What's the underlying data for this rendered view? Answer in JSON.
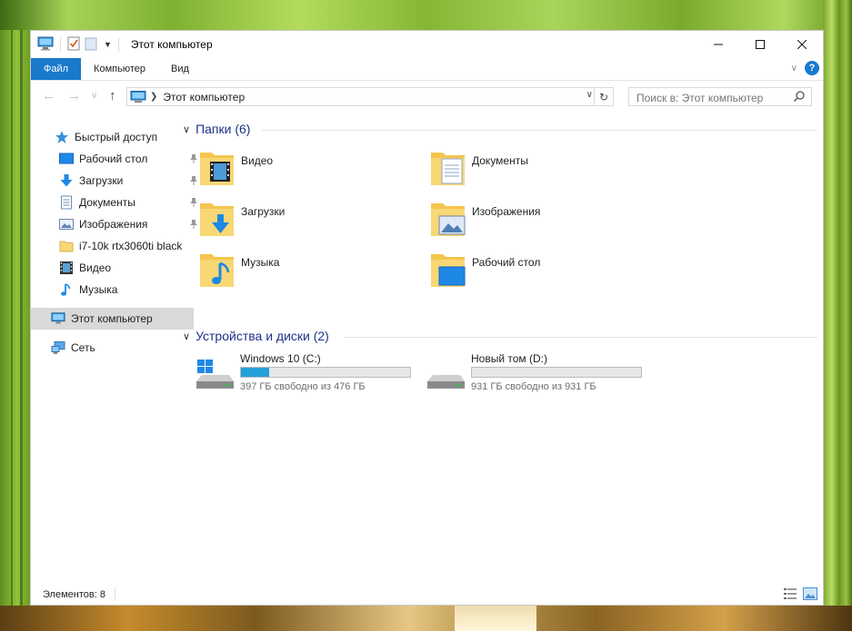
{
  "window": {
    "title": "Этот компьютер"
  },
  "ribbon": {
    "tabs": [
      "Файл",
      "Компьютер",
      "Вид"
    ],
    "help": "?"
  },
  "address": {
    "location": "Этот компьютер",
    "search_placeholder": "Поиск в: Этот компьютер"
  },
  "nav": {
    "quick_access": "Быстрый доступ",
    "pinned": [
      "Рабочий стол",
      "Загрузки",
      "Документы",
      "Изображения"
    ],
    "recent": [
      "i7-10k rtx3060ti black",
      "Видео",
      "Музыка"
    ],
    "this_pc": "Этот компьютер",
    "network": "Сеть"
  },
  "folders": {
    "header": "Папки (6)",
    "items": [
      "Видео",
      "Документы",
      "Загрузки",
      "Изображения",
      "Музыка",
      "Рабочий стол"
    ]
  },
  "devices": {
    "header": "Устройства и диски (2)",
    "drives": [
      {
        "name": "Windows 10 (C:)",
        "free": "397 ГБ свободно из 476 ГБ",
        "used_fraction": 0.166
      },
      {
        "name": "Новый том (D:)",
        "free": "931 ГБ свободно из 931 ГБ",
        "used_fraction": 0.0
      }
    ]
  },
  "status": {
    "count": "Элементов: 8"
  },
  "colors": {
    "accent": "#1979ca",
    "header_text": "#1e3287",
    "drive_fill": "#26a0da",
    "selection": "#d9d9d9"
  }
}
